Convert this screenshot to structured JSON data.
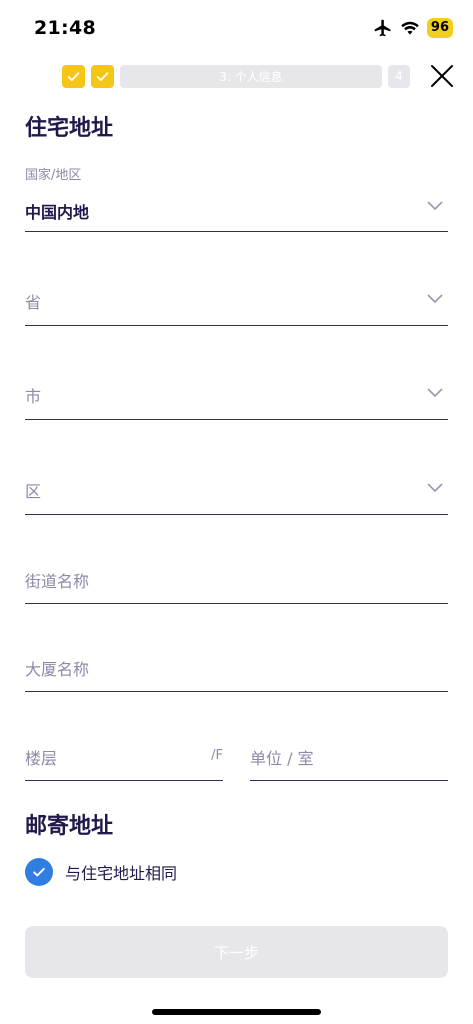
{
  "status_bar": {
    "time": "21:48",
    "battery": "96"
  },
  "progress": {
    "current_step": "3. 个人信息",
    "next_step": "4"
  },
  "residential": {
    "title": "住宅地址",
    "region": {
      "label": "国家/地区",
      "value": "中国内地"
    },
    "province": {
      "placeholder": "省"
    },
    "city": {
      "placeholder": "市"
    },
    "district": {
      "placeholder": "区"
    },
    "street": {
      "placeholder": "街道名称"
    },
    "building": {
      "placeholder": "大厦名称"
    },
    "floor": {
      "placeholder": "楼层",
      "suffix": "/F"
    },
    "unit": {
      "placeholder": "单位 / 室"
    }
  },
  "mailing": {
    "title": "邮寄地址",
    "same_as_residential": {
      "label": "与住宅地址相同",
      "checked": true
    }
  },
  "next_button": {
    "label": "下一步"
  }
}
